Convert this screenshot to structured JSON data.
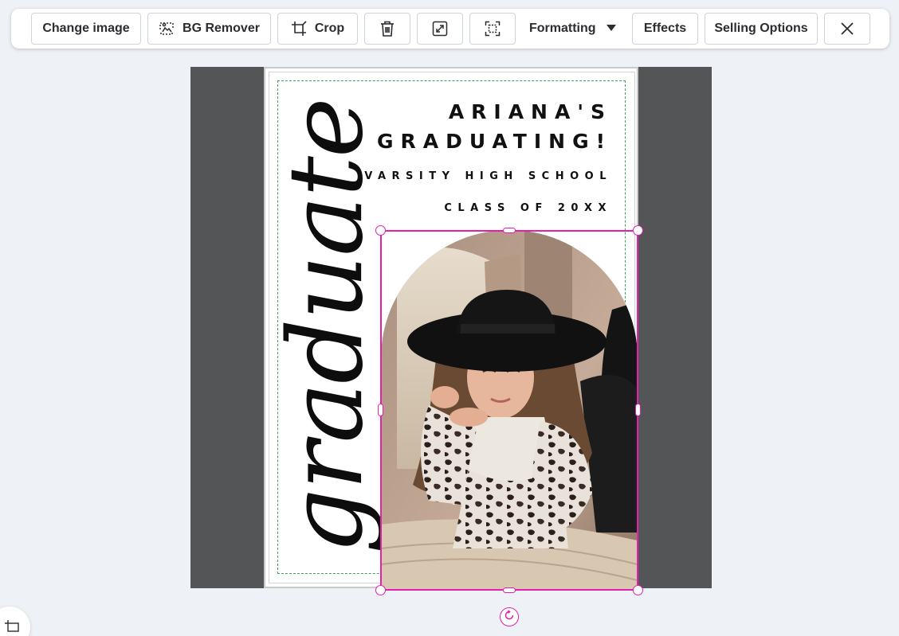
{
  "toolbar": {
    "change_image": "Change image",
    "bg_remover": "BG Remover",
    "crop": "Crop",
    "formatting": "Formatting",
    "effects": "Effects",
    "selling_options": "Selling Options"
  },
  "design": {
    "title_line_1": "ARIANA'S",
    "title_line_2": "GRADUATING!",
    "school": "VARSITY HIGH SCHOOL",
    "class_of": "CLASS OF 20XX",
    "script_word": "graduate"
  },
  "colors": {
    "selection": "#e21fae",
    "safe_zone": "#3fa05a",
    "canvas_bg": "#545556",
    "page_bg": "#eef1f6"
  },
  "icons": [
    "bg-remover-icon",
    "crop-icon",
    "trash-icon",
    "expand-icon",
    "fit-frame-icon",
    "caret-down-icon",
    "close-icon",
    "rotate-icon",
    "crop-frame-icon"
  ]
}
